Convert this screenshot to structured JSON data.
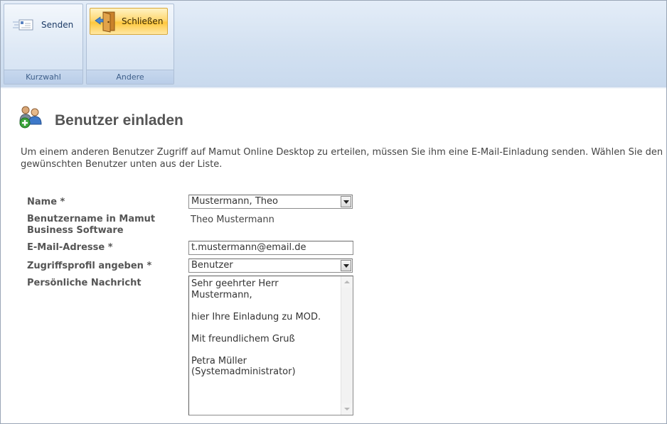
{
  "ribbon": {
    "groups": [
      {
        "label": "Kurzwahl",
        "button": {
          "label": "Senden",
          "icon": "envelope-icon"
        }
      },
      {
        "label": "Andere",
        "button": {
          "label": "Schließen",
          "icon": "door-exit-icon"
        }
      }
    ]
  },
  "page": {
    "title": "Benutzer einladen",
    "title_icon": "add-users-icon",
    "intro": "Um einem anderen Benutzer Zugriff auf Mamut Online Desktop zu erteilen, müssen Sie ihm eine E-Mail-Einladung senden. Wählen Sie den gewünschten Benutzer unten aus der Liste."
  },
  "form": {
    "name": {
      "label": "Name *",
      "value": "Mustermann, Theo"
    },
    "username": {
      "label": "Benutzername in Mamut Business Software",
      "value": "Theo Mustermann"
    },
    "email": {
      "label": "E-Mail-Adresse *",
      "value": "t.mustermann@email.de"
    },
    "profile": {
      "label": "Zugriffsprofil angeben *",
      "value": "Benutzer"
    },
    "message": {
      "label": "Persönliche Nachricht",
      "value": "Sehr geehrter Herr Mustermann,\n\nhier Ihre Einladung zu MOD.\n\nMit freundlichem Gruß\n\nPetra Müller\n(Systemadministrator)"
    }
  },
  "colors": {
    "ribbon": "#d3e1f1",
    "active_button": "#ffc83d",
    "title": "#555555"
  }
}
